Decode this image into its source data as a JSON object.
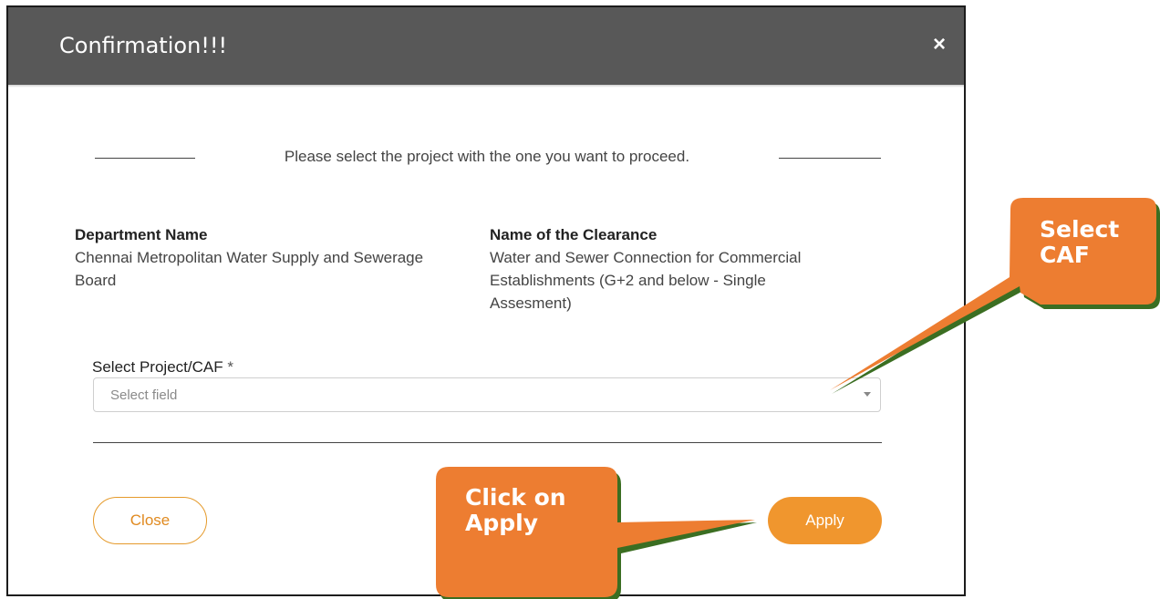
{
  "dialog": {
    "title": "Confirmation!!!",
    "close_glyph": "×",
    "prompt": "Please select the project with the one you want to proceed.",
    "department": {
      "label": "Department Name",
      "value_lines": [
        "Chennai Metropolitan Water Supply and Sewerage",
        "Board"
      ]
    },
    "clearance": {
      "label": "Name of the Clearance",
      "value_lines": [
        "Water and Sewer Connection for Commercial",
        "Establishments (G+2 and below - Single",
        "Assesment)"
      ]
    },
    "project_field": {
      "label": "Select Project/CAF",
      "required_mark": "*",
      "placeholder": "Select field"
    },
    "buttons": {
      "close": "Close",
      "apply": "Apply"
    }
  },
  "callouts": [
    {
      "lines": [
        "Select",
        "CAF"
      ]
    },
    {
      "lines": [
        "Click on",
        "Apply"
      ]
    }
  ],
  "colors": {
    "header_bg": "#585858",
    "accent_orange": "#f0962e",
    "callout_fill": "#ed7d31",
    "callout_shadow": "#3b6e22"
  },
  "icons": {
    "dropdown": "caret-down-icon",
    "close": "close-icon"
  }
}
